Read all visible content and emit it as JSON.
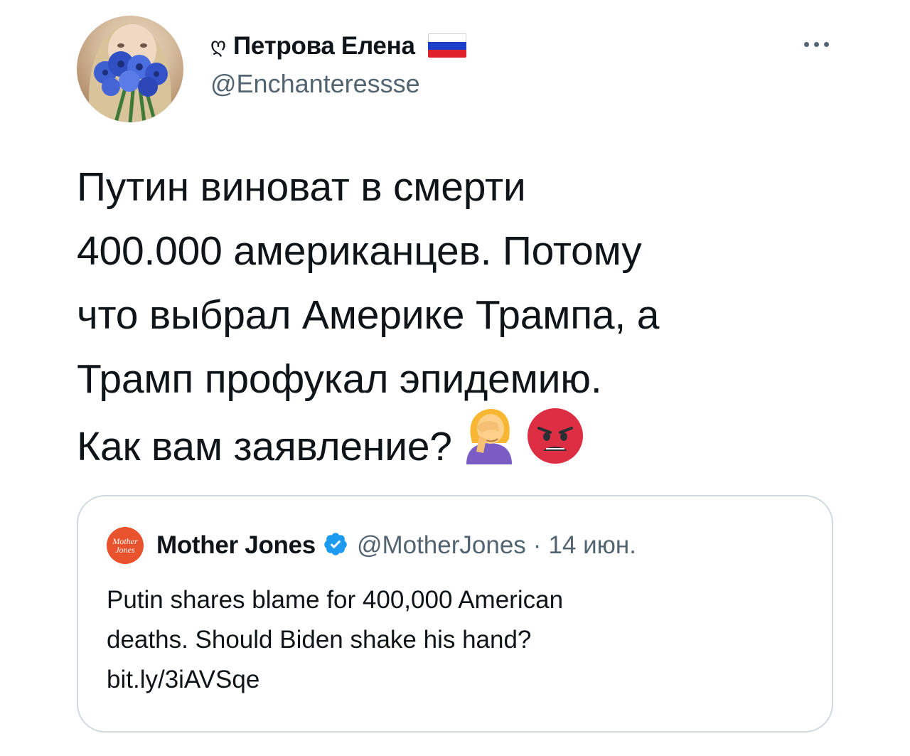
{
  "author": {
    "name_glyph": "ღ",
    "display_name": "Петрова Елена",
    "handle": "@Enchanteressse",
    "flag_colors": [
      "#ffffff",
      "#1c3fc8",
      "#e0212b"
    ],
    "avatar_icon": "woman-with-cornflowers-avatar"
  },
  "more_button": {
    "icon": "more-horizontal-icon"
  },
  "tweet": {
    "lines": [
      "Путин виноват в смерти",
      "400.000 американцев. Потому",
      "что выбрал Америке Трампа, а",
      "Трамп профукал эпидемию.",
      "Как вам заявление?"
    ],
    "emojis": [
      "woman-facepalming-emoji",
      "angry-face-emoji"
    ]
  },
  "quote": {
    "avatar_text": [
      "Mother",
      "Jones"
    ],
    "name": "Mother Jones",
    "verified_icon": "verified-badge-icon",
    "handle": "@MotherJones",
    "separator": "·",
    "date": "14 июн.",
    "lines": [
      "Putin shares blame for 400,000 American",
      "deaths. Should Biden shake his hand?",
      "bit.ly/3iAVSqe"
    ]
  },
  "colors": {
    "text": "#0f1419",
    "secondary": "#536471",
    "border": "#cfd9de",
    "verified": "#1d9bf0",
    "quote_avatar": "#e8532e"
  }
}
